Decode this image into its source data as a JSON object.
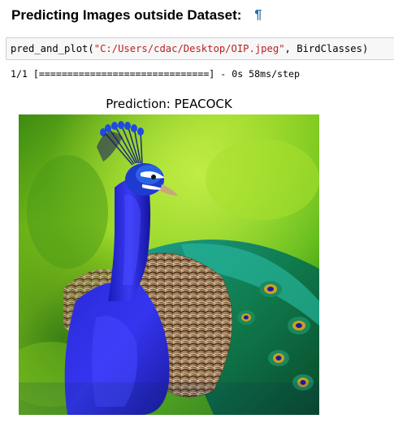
{
  "markdown": {
    "heading": "Predicting Images outside Dataset:",
    "anchor_symbol": "¶"
  },
  "code_cell": {
    "func_name": "pred_and_plot",
    "open_paren": "(",
    "path_string": "\"C:/Users/cdac/Desktop/OIP.jpeg\"",
    "separator": ", ",
    "arg_name": "BirdClasses",
    "close_paren": ")"
  },
  "output": {
    "progress_line": "1/1 [==============================] - 0s 58ms/step"
  },
  "plot": {
    "title": "Prediction: PEACOCK",
    "image_subject": "peacock-photo"
  }
}
